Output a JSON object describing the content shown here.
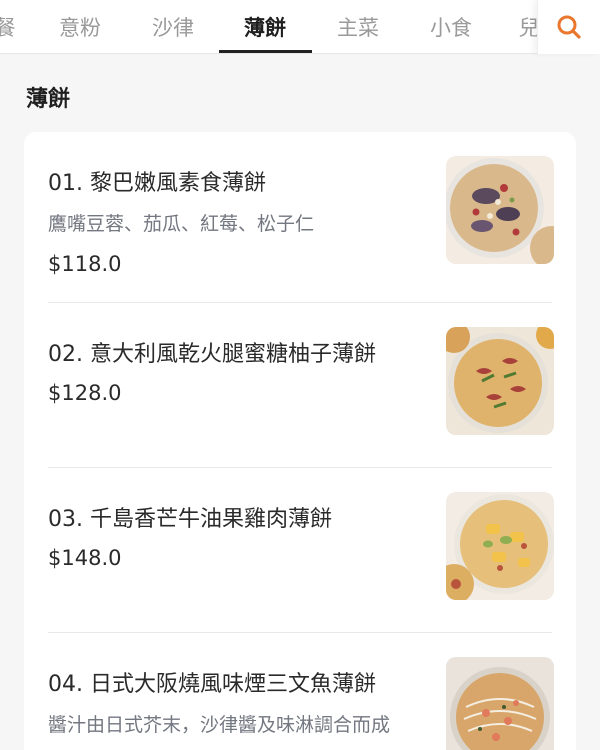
{
  "tabs": [
    {
      "label": "餐",
      "active": false
    },
    {
      "label": "意粉",
      "active": false
    },
    {
      "label": "沙律",
      "active": false
    },
    {
      "label": "薄餅",
      "active": true
    },
    {
      "label": "主菜",
      "active": false
    },
    {
      "label": "小食",
      "active": false
    },
    {
      "label": "兒",
      "active": false
    }
  ],
  "search_icon": "search-icon",
  "colors": {
    "accent": "#e9772e",
    "tab_inactive": "#9a9a9a",
    "desc": "#737780"
  },
  "section": {
    "title": "薄餅"
  },
  "items": [
    {
      "name": "01. 黎巴嫩風素食薄餅",
      "description": "鷹嘴豆蓉、茄瓜、紅莓、松子仁",
      "price": "$118.0"
    },
    {
      "name": "02. 意大利風乾火腿蜜糖柚子薄餅",
      "price": "$128.0"
    },
    {
      "name": "03. 千島香芒牛油果雞肉薄餅",
      "price": "$148.0"
    },
    {
      "name": "04. 日式大阪燒風味煙三文魚薄餅",
      "description": "醬汁由日式芥末，沙律醬及味淋調合而成"
    }
  ]
}
